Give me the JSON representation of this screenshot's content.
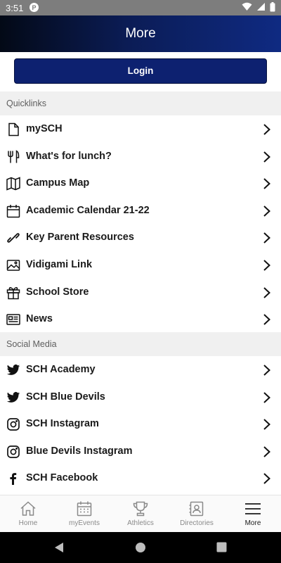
{
  "status_bar": {
    "time": "3:51"
  },
  "header": {
    "title": "More"
  },
  "login": {
    "label": "Login"
  },
  "quicklinks": {
    "title": "Quicklinks",
    "items": [
      {
        "label": "mySCH",
        "icon": "document-icon"
      },
      {
        "label": "What's for lunch?",
        "icon": "utensils-icon"
      },
      {
        "label": "Campus Map",
        "icon": "map-icon"
      },
      {
        "label": "Academic Calendar 21-22",
        "icon": "calendar-icon"
      },
      {
        "label": "Key Parent Resources",
        "icon": "link-icon"
      },
      {
        "label": "Vidigami Link",
        "icon": "image-icon"
      },
      {
        "label": "School Store",
        "icon": "gift-icon"
      },
      {
        "label": "News",
        "icon": "newspaper-icon"
      }
    ]
  },
  "social": {
    "title": "Social Media",
    "items": [
      {
        "label": "SCH Academy",
        "icon": "twitter-icon"
      },
      {
        "label": "SCH Blue Devils",
        "icon": "twitter-icon"
      },
      {
        "label": "SCH Instagram",
        "icon": "instagram-icon"
      },
      {
        "label": "Blue Devils Instagram",
        "icon": "instagram-icon"
      },
      {
        "label": "SCH Facebook",
        "icon": "facebook-icon"
      }
    ]
  },
  "tabs": [
    {
      "label": "Home",
      "icon": "home-icon"
    },
    {
      "label": "myEvents",
      "icon": "calendar-icon"
    },
    {
      "label": "Athletics",
      "icon": "trophy-icon"
    },
    {
      "label": "Directories",
      "icon": "contact-card-icon"
    },
    {
      "label": "More",
      "icon": "menu-icon",
      "active": true
    }
  ]
}
